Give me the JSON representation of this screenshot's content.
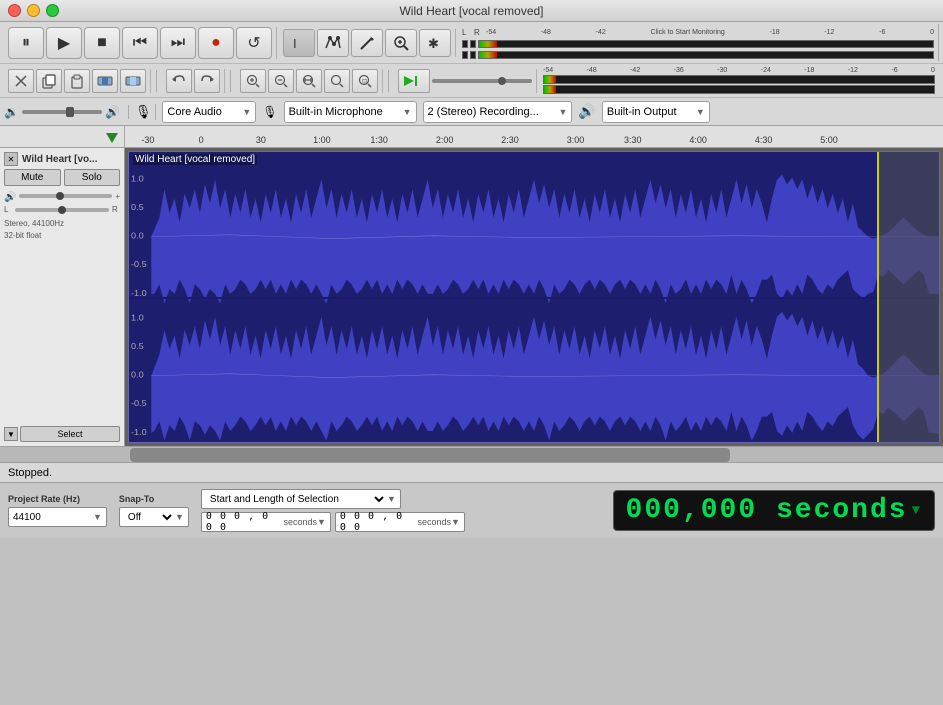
{
  "window": {
    "title": "Wild Heart [vocal removed]"
  },
  "transport": {
    "pause_label": "⏸",
    "play_label": "▶",
    "stop_label": "■",
    "skip_back_label": "⏮",
    "skip_fwd_label": "⏭",
    "record_label": "●",
    "loop_label": "↺"
  },
  "tools": {
    "select_label": "I",
    "multi_label": "⊕",
    "draw_label": "✏",
    "zoom_in_label": "🔍",
    "star_label": "✱",
    "zoom_label": "🔎",
    "speaker_label": "♪",
    "undo_label": "↩",
    "redo_label": "↪",
    "zoom_in2": "+",
    "zoom_out": "−",
    "zoom_fit": "⊡",
    "zoom_sel": "⊟",
    "zoom_end": "⊞",
    "envelope": "~"
  },
  "volume": {
    "level": 0.7
  },
  "vu_meter": {
    "l_label": "L",
    "r_label": "R",
    "marks": [
      "-54",
      "-48",
      "-42",
      "Click to Start Monitoring",
      "-18",
      "-12",
      "-6",
      "0"
    ],
    "marks2": [
      "-54",
      "-48",
      "-42",
      "-36",
      "-30",
      "-24",
      "-18",
      "-12",
      "-6",
      "0"
    ]
  },
  "devices": {
    "audio_host": "Core Audio",
    "input_device": "Built-in Microphone",
    "channels": "2 (Stereo) Recording...",
    "output_device": "Built-in Output"
  },
  "timeline": {
    "marks": [
      "-30",
      "0",
      "30",
      "1:00",
      "1:30",
      "2:00",
      "2:30",
      "3:00",
      "3:30",
      "4:00",
      "4:30",
      "5:00"
    ]
  },
  "track": {
    "name": "Wild Heart [vo...",
    "full_name": "Wild Heart [vocal removed]",
    "mute_label": "Mute",
    "solo_label": "Solo",
    "info": "Stereo, 44100Hz\n32-bit float",
    "select_label": "Select"
  },
  "status": {
    "text": "Stopped."
  },
  "bottom": {
    "project_rate_label": "Project Rate (Hz)",
    "project_rate_value": "44100",
    "snap_to_label": "Snap-To",
    "snap_off": "Off",
    "selection_label": "Start and Length of Selection",
    "sel1_value": "0 0 0 , 0 0 0  seconds",
    "sel2_value": "0 0 0 , 0 0 0  seconds",
    "time_display": "0 0 0 , 0 0 0  seconds"
  }
}
